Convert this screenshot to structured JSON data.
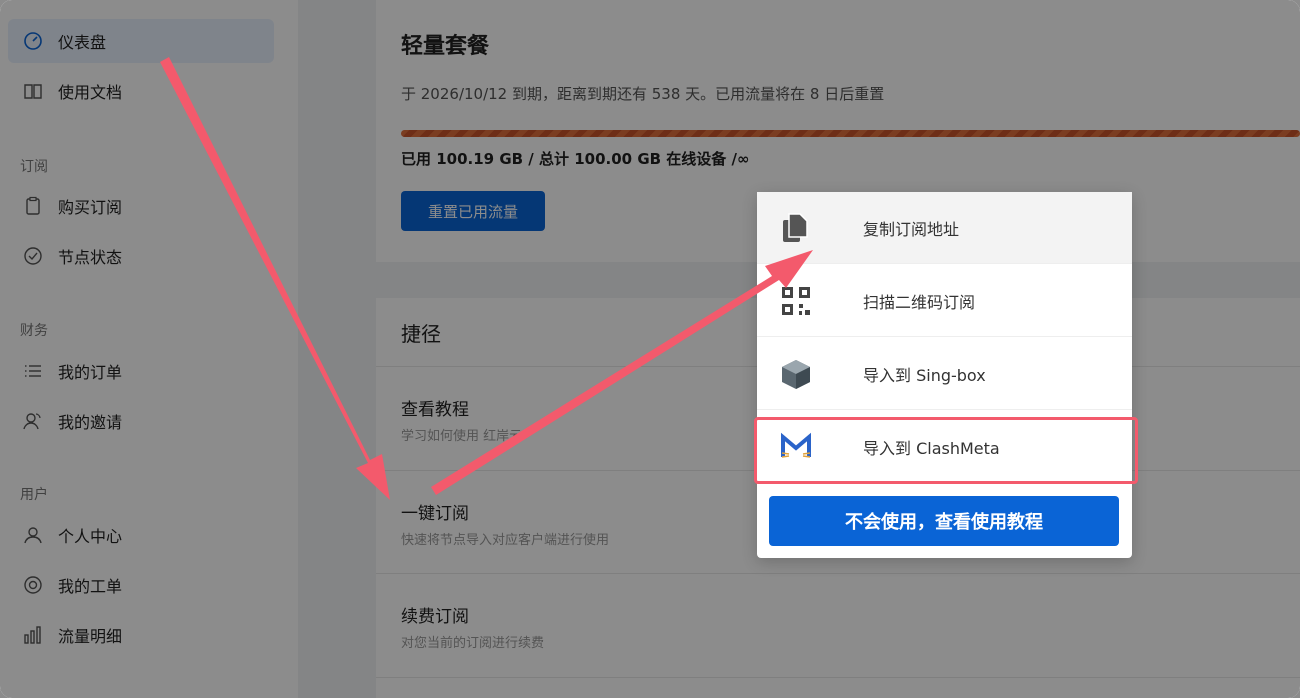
{
  "sidebar": {
    "items": [
      {
        "label": "仪表盘",
        "icon": "dashboard-icon"
      },
      {
        "label": "使用文档",
        "icon": "book-icon"
      },
      {
        "label": "购买订阅",
        "icon": "clipboard-icon"
      },
      {
        "label": "节点状态",
        "icon": "check-circle-icon"
      },
      {
        "label": "我的订单",
        "icon": "list-icon"
      },
      {
        "label": "我的邀请",
        "icon": "users-icon"
      },
      {
        "label": "个人中心",
        "icon": "user-icon"
      },
      {
        "label": "我的工单",
        "icon": "lifebuoy-icon"
      },
      {
        "label": "流量明细",
        "icon": "bar-chart-icon"
      }
    ],
    "groups": {
      "subscribe": "订阅",
      "finance": "财务",
      "user": "用户"
    }
  },
  "plan": {
    "title": "轻量套餐",
    "description": "于 2026/10/12 到期，距离到期还有 538 天。已用流量将在 8 日后重置",
    "usage": "已用 100.19 GB / 总计 100.00 GB 在线设备 /∞",
    "usage_fraction": 1.0,
    "reset_button": "重置已用流量"
  },
  "shortcuts": {
    "title": "捷径",
    "rows": [
      {
        "title": "查看教程",
        "subtitle": "学习如何使用 红岸云"
      },
      {
        "title": "一键订阅",
        "subtitle": "快速将节点导入对应客户端进行使用"
      },
      {
        "title": "续费订阅",
        "subtitle": "对您当前的订阅进行续费"
      }
    ]
  },
  "menu": {
    "items": [
      {
        "label": "复制订阅地址",
        "icon": "copy-icon"
      },
      {
        "label": "扫描二维码订阅",
        "icon": "qrcode-icon"
      },
      {
        "label": "导入到 Sing-box",
        "icon": "singbox-icon"
      },
      {
        "label": "导入到 ClashMeta",
        "icon": "clashmeta-icon"
      }
    ],
    "tutorial_button": "不会使用，查看使用教程"
  },
  "colors": {
    "primary": "#0a64d6",
    "progress": "#e0703c",
    "annotation": "#f35a6c"
  }
}
